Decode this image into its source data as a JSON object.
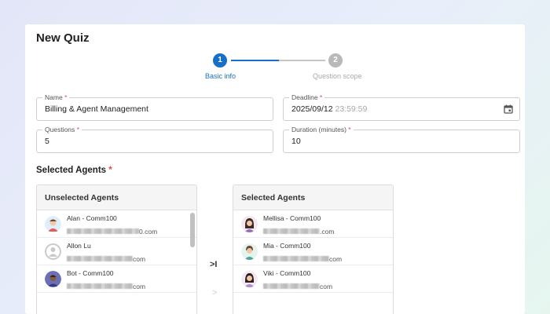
{
  "page_title": "New Quiz",
  "stepper": {
    "steps": [
      {
        "number": "1",
        "label": "Basic info"
      },
      {
        "number": "2",
        "label": "Question scope"
      }
    ]
  },
  "form": {
    "name": {
      "label": "Name",
      "required": "*",
      "value": "Billing & Agent Management"
    },
    "deadline": {
      "label": "Deadline",
      "required": "*",
      "date": "2025/09/12",
      "time": "23:59:59"
    },
    "questions": {
      "label": "Questions",
      "required": "*",
      "value": "5"
    },
    "duration": {
      "label": "Duration (minutes)",
      "required": "*",
      "value": "10"
    }
  },
  "selected_agents_section": {
    "title": "Selected Agents",
    "required": "*"
  },
  "unselected_panel": {
    "title": "Unselected Agents",
    "agents": [
      {
        "name": "Alan - Comm100",
        "email_suffix": "0.com"
      },
      {
        "name": "Allon Lu",
        "email_suffix": "com"
      },
      {
        "name": "Bot - Comm100",
        "email_suffix": "com"
      }
    ]
  },
  "selected_panel": {
    "title": "Selected Agents",
    "agents": [
      {
        "name": "Mellisa - Comm100",
        "email_suffix": ".com"
      },
      {
        "name": "Mia - Comm100",
        "email_suffix": "com"
      },
      {
        "name": "Viki - Comm100",
        "email_suffix": "com"
      }
    ]
  },
  "transfer": {
    "move_all_label": ">I",
    "move_one_label": ">"
  },
  "colors": {
    "accent": "#1670c8",
    "required": "#e24a4a",
    "inactive": "#b9b9b9"
  }
}
